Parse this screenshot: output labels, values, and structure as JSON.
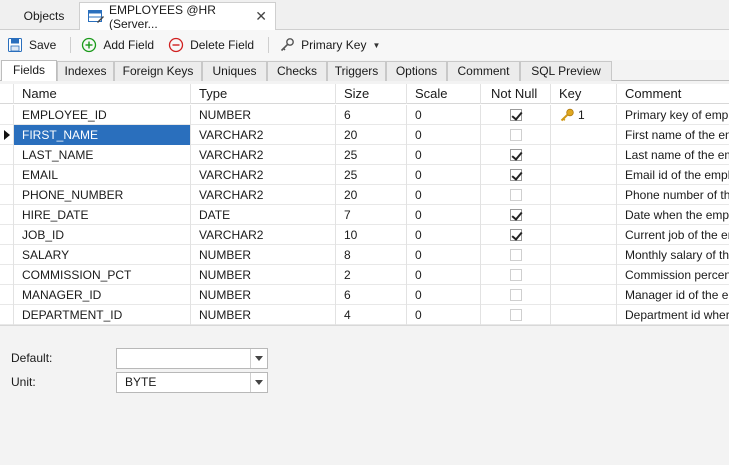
{
  "doc_tabs": {
    "objects": "Objects",
    "active": "EMPLOYEES @HR (Server..."
  },
  "toolbar": {
    "save": "Save",
    "add_field": "Add Field",
    "delete_field": "Delete Field",
    "primary_key": "Primary Key"
  },
  "sub_tabs": [
    "Fields",
    "Indexes",
    "Foreign Keys",
    "Uniques",
    "Checks",
    "Triggers",
    "Options",
    "Comment",
    "SQL Preview"
  ],
  "columns": {
    "name": "Name",
    "type": "Type",
    "size": "Size",
    "scale": "Scale",
    "not_null": "Not Null",
    "key": "Key",
    "comment": "Comment"
  },
  "rows": [
    {
      "name": "EMPLOYEE_ID",
      "type": "NUMBER",
      "size": "6",
      "scale": "0",
      "not_null": true,
      "key": "1",
      "comment": "Primary key of employees"
    },
    {
      "name": "FIRST_NAME",
      "type": "VARCHAR2",
      "size": "20",
      "scale": "0",
      "not_null": false,
      "key": "",
      "comment": "First name of the employee"
    },
    {
      "name": "LAST_NAME",
      "type": "VARCHAR2",
      "size": "25",
      "scale": "0",
      "not_null": true,
      "key": "",
      "comment": "Last name of the employee"
    },
    {
      "name": "EMAIL",
      "type": "VARCHAR2",
      "size": "25",
      "scale": "0",
      "not_null": true,
      "key": "",
      "comment": "Email id of the employee"
    },
    {
      "name": "PHONE_NUMBER",
      "type": "VARCHAR2",
      "size": "20",
      "scale": "0",
      "not_null": false,
      "key": "",
      "comment": "Phone number of the employee"
    },
    {
      "name": "HIRE_DATE",
      "type": "DATE",
      "size": "7",
      "scale": "0",
      "not_null": true,
      "key": "",
      "comment": "Date when the employee"
    },
    {
      "name": "JOB_ID",
      "type": "VARCHAR2",
      "size": "10",
      "scale": "0",
      "not_null": true,
      "key": "",
      "comment": "Current job of the employee"
    },
    {
      "name": "SALARY",
      "type": "NUMBER",
      "size": "8",
      "scale": "0",
      "not_null": false,
      "key": "",
      "comment": "Monthly salary of the employee"
    },
    {
      "name": "COMMISSION_PCT",
      "type": "NUMBER",
      "size": "2",
      "scale": "0",
      "not_null": false,
      "key": "",
      "comment": "Commission percentage"
    },
    {
      "name": "MANAGER_ID",
      "type": "NUMBER",
      "size": "6",
      "scale": "0",
      "not_null": false,
      "key": "",
      "comment": "Manager id of the employee"
    },
    {
      "name": "DEPARTMENT_ID",
      "type": "NUMBER",
      "size": "4",
      "scale": "0",
      "not_null": false,
      "key": "",
      "comment": "Department id where employee works"
    }
  ],
  "selected_row": 1,
  "props": {
    "default_label": "Default:",
    "default_value": "",
    "unit_label": "Unit:",
    "unit_value": "BYTE"
  },
  "colors": {
    "selection": "#2a6fbd",
    "add_icon": "#1a9a1a",
    "delete_icon": "#d02020",
    "key_icon": "#d9a020"
  }
}
